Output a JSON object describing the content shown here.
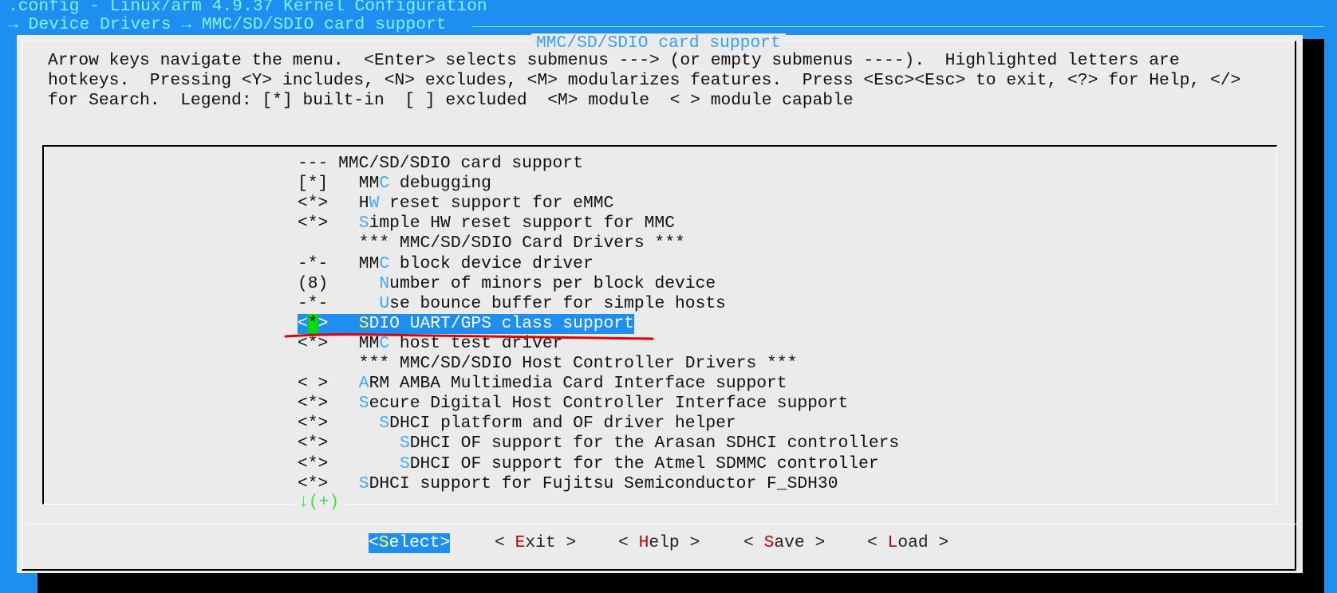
{
  "window": {
    "title": ".config - Linux/arm 4.9.37 Kernel Configuration",
    "breadcrumb": "→ Device Drivers → MMC/SD/SDIO card support"
  },
  "dialog": {
    "title": "MMC/SD/SDIO card support",
    "help_lines": [
      "Arrow keys navigate the menu.  <Enter> selects submenus ---> (or empty submenus ----).  Highlighted letters are",
      "hotkeys.  Pressing <Y> includes, <N> excludes, <M> modularizes features.  Press <Esc><Esc> to exit, <?> for Help, </>",
      "for Search.  Legend: [*] built-in  [ ] excluded  <M> module  < > module capable"
    ],
    "menu_items": [
      {
        "state": "---",
        "label": "MMC/SD/SDIO card support",
        "level": 0,
        "hotkey_index": -1,
        "header": true
      },
      {
        "state": "[*]",
        "label": "MMC debugging",
        "level": 0,
        "hotkey_index": 2
      },
      {
        "state": "<*>",
        "label": "HW reset support for eMMC",
        "level": 0,
        "hotkey_index": 1
      },
      {
        "state": "<*>",
        "label": "Simple HW reset support for MMC",
        "level": 0,
        "hotkey_index": 0
      },
      {
        "state": "",
        "label": "*** MMC/SD/SDIO Card Drivers ***",
        "level": 0,
        "hotkey_index": -1
      },
      {
        "state": "-*-",
        "label": "MMC block device driver",
        "level": 0,
        "hotkey_index": 2
      },
      {
        "state": "(8)",
        "label": "Number of minors per block device",
        "level": 1,
        "hotkey_index": 0
      },
      {
        "state": "-*-",
        "label": "Use bounce buffer for simple hosts",
        "level": 1,
        "hotkey_index": 0
      },
      {
        "state": "<*>",
        "label": "SDIO UART/GPS class support",
        "level": 0,
        "hotkey_index": 0,
        "selected": true
      },
      {
        "state": "<*>",
        "label": "MMC host test driver",
        "level": 0,
        "hotkey_index": 2
      },
      {
        "state": "",
        "label": "*** MMC/SD/SDIO Host Controller Drivers ***",
        "level": 0,
        "hotkey_index": -1
      },
      {
        "state": "< >",
        "label": "ARM AMBA Multimedia Card Interface support",
        "level": 0,
        "hotkey_index": 0
      },
      {
        "state": "<*>",
        "label": "Secure Digital Host Controller Interface support",
        "level": 0,
        "hotkey_index": 0
      },
      {
        "state": "<*>",
        "label": "SDHCI platform and OF driver helper",
        "level": 1,
        "hotkey_index": 0
      },
      {
        "state": "<*>",
        "label": "SDHCI OF support for the Arasan SDHCI controllers",
        "level": 2,
        "hotkey_index": 0
      },
      {
        "state": "<*>",
        "label": "SDHCI OF support for the Atmel SDMMC controller",
        "level": 2,
        "hotkey_index": 0
      },
      {
        "state": "<*>",
        "label": "SDHCI support for Fujitsu Semiconductor F_SDH30",
        "level": 0,
        "hotkey_index": 0
      }
    ],
    "more_indicator": "↓(+)",
    "buttons": [
      {
        "pre": "<",
        "hot": "S",
        "rest": "elect",
        "post": ">",
        "active": true
      },
      {
        "pre": "< ",
        "hot": "E",
        "rest": "xit",
        "post": " >"
      },
      {
        "pre": "< ",
        "hot": "H",
        "rest": "elp",
        "post": " >"
      },
      {
        "pre": "< ",
        "hot": "S",
        "rest": "ave",
        "post": " >"
      },
      {
        "pre": "< ",
        "hot": "L",
        "rest": "oad",
        "post": " >"
      }
    ]
  },
  "colors": {
    "background": "#1e8ff0",
    "hotkey": "#3fa9f5",
    "selected_hotkey": "#ffff40",
    "button_hotkey": "#c00000",
    "annotation": "#e00000"
  }
}
